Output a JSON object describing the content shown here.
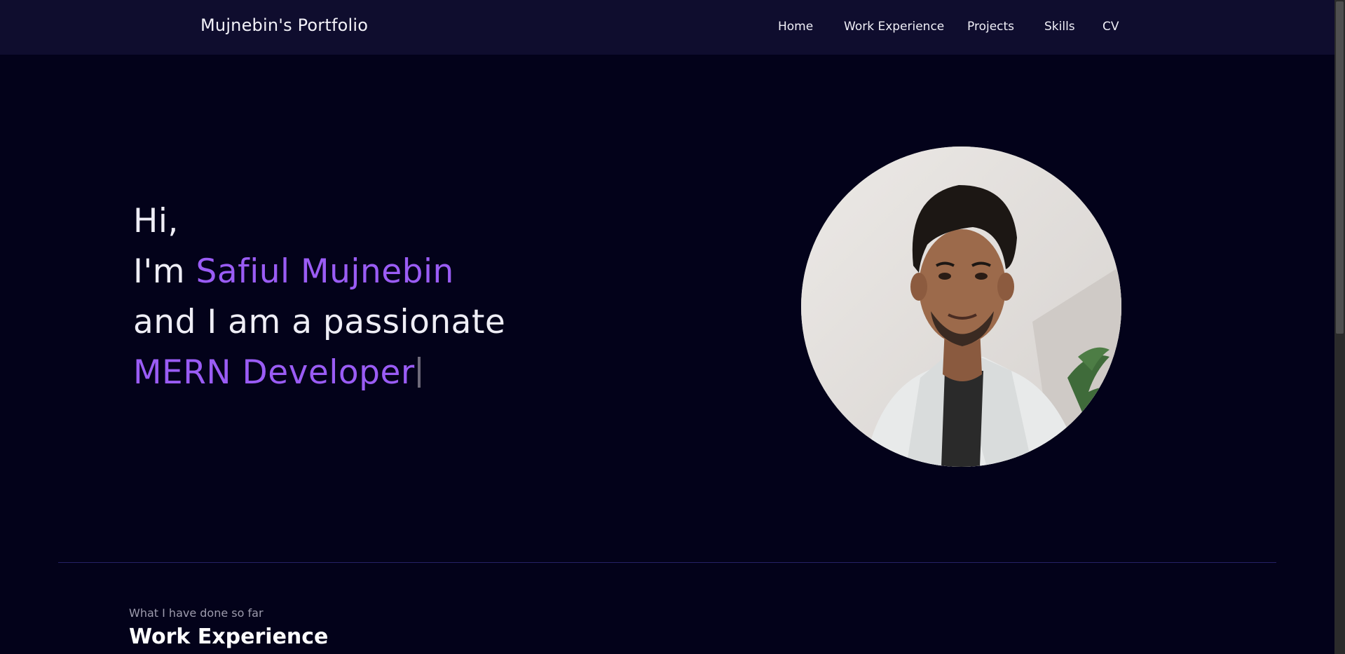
{
  "navbar": {
    "brand": "Mujnebin's Portfolio",
    "links": [
      "Home",
      "Work Experience",
      "Projects",
      "Skills",
      "CV"
    ]
  },
  "hero": {
    "greeting": "Hi,",
    "intro_prefix": "I'm ",
    "name": "Safiul Mujnebin",
    "tagline": "and I am a passionate",
    "role": "MERN Developer"
  },
  "work_section": {
    "subtitle": "What I have done so far",
    "title": "Work Experience"
  },
  "colors": {
    "background": "#03021a",
    "navbar": "#0f0d2e",
    "accent": "#9a5cf5",
    "text": "#efeef6"
  }
}
